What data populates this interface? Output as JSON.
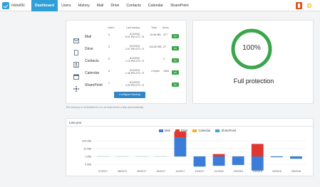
{
  "app": {
    "logo_text": "nexetic"
  },
  "nav": [
    {
      "label": "Dashboard",
      "active": true
    },
    {
      "label": "Users",
      "active": false
    },
    {
      "label": "History",
      "active": false
    },
    {
      "label": "Mail",
      "active": false
    },
    {
      "label": "Drive",
      "active": false
    },
    {
      "label": "Contacts",
      "active": false
    },
    {
      "label": "Calendar",
      "active": false
    },
    {
      "label": "SharePoint",
      "active": false
    }
  ],
  "backup": {
    "headers": {
      "users": "Users",
      "last_backup": "Last backup",
      "total": "Total",
      "items": "Items"
    },
    "rows": [
      {
        "service": "Mail",
        "icon": "mail-icon",
        "users": "5",
        "last_date": "6/1/2018",
        "last_time": "6:01 PM UTC +3",
        "total": "10.96 MB",
        "items": "377",
        "status": "OK"
      },
      {
        "service": "Drive",
        "icon": "drive-file-icon",
        "users": "5",
        "last_date": "6/1/2018",
        "last_time": "1:07 PM UTC +3",
        "total": "104.82 MB",
        "items": "27",
        "status": "OK"
      },
      {
        "service": "Contacts",
        "icon": "contacts-icon",
        "users": "5",
        "last_date": "6/1/2018",
        "last_time": "1:19 PM UTC +3",
        "total": "",
        "items": "3",
        "status": "OK"
      },
      {
        "service": "Calendar",
        "icon": "calendar-icon",
        "users": "5",
        "last_date": "6/1/2018",
        "last_time": "1:46 PM UTC +3",
        "total": "0 bytes",
        "items": "1084",
        "status": "OK"
      },
      {
        "service": "SharePoint",
        "icon": "sharepoint-icon",
        "users": "1",
        "last_date": "6/1/2018",
        "last_time": "2:33 PM UTC +3",
        "total": "",
        "items": "",
        "status": "OK"
      }
    ],
    "configure_label": "Configure Backup",
    "note": "The backup is scheduled to run at least twice a day automatically"
  },
  "protection": {
    "percent_label": "100%",
    "percent_value": 100,
    "label": "Full protection",
    "color": "#3aa64a"
  },
  "chart_data": {
    "type": "bar",
    "title": "Last year",
    "categories": [
      "07/2017",
      "08/2017",
      "09/2017",
      "10/2017",
      "11/2017",
      "12/2017",
      "01/2018",
      "02/2018",
      "03/2018",
      "04/2018",
      "05/2018"
    ],
    "y_ticks": [
      "100 MB",
      "10 MB",
      "1 MB",
      "0 MB"
    ],
    "series": [
      {
        "name": "Mail",
        "color": "#3b7dd8",
        "values": [
          0,
          0,
          0,
          0,
          2.4,
          -1.3,
          -1.2,
          -1.1,
          -1.8,
          -0.1,
          -0.3
        ]
      },
      {
        "name": "Drive",
        "color": "#e0372f",
        "values": [
          0,
          0,
          0,
          0,
          3.2,
          0,
          0.3,
          0,
          1.6,
          0,
          0
        ]
      },
      {
        "name": "Calendar",
        "color": "#f2b21e",
        "values": [
          0,
          0,
          0,
          0,
          0,
          0,
          0,
          0,
          0,
          0,
          0
        ]
      },
      {
        "name": "SharePoint",
        "color": "#36a3d9",
        "values": [
          0,
          0,
          0,
          0,
          0,
          0,
          0,
          0,
          0,
          0,
          0
        ]
      }
    ]
  }
}
